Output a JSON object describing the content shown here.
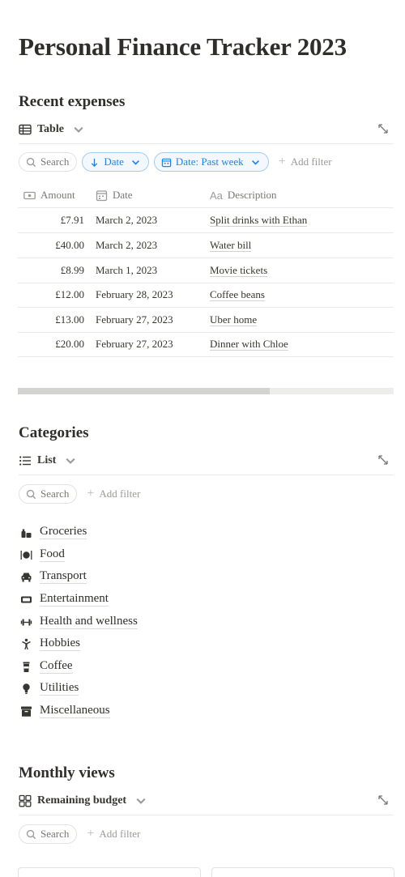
{
  "page": {
    "title": "Personal Finance Tracker 2023"
  },
  "expenses": {
    "section_title": "Recent expenses",
    "view_label": "Table",
    "search_label": "Search",
    "sort_label": "Date",
    "date_filter_label": "Date: Past week",
    "add_filter_label": "Add filter",
    "columns": {
      "amount": "Amount",
      "date": "Date",
      "description": "Description"
    },
    "rows": [
      {
        "amount": "£7.91",
        "date": "March 2, 2023",
        "description": "Split drinks with Ethan"
      },
      {
        "amount": "£40.00",
        "date": "March 2, 2023",
        "description": "Water bill"
      },
      {
        "amount": "£8.99",
        "date": "March 1, 2023",
        "description": "Movie tickets"
      },
      {
        "amount": "£12.00",
        "date": "February 28, 2023",
        "description": "Coffee beans"
      },
      {
        "amount": "£13.00",
        "date": "February 27, 2023",
        "description": "Uber home"
      },
      {
        "amount": "£20.00",
        "date": "February 27, 2023",
        "description": "Dinner with Chloe"
      }
    ],
    "scroll_fraction": 0.67
  },
  "categories": {
    "section_title": "Categories",
    "view_label": "List",
    "search_label": "Search",
    "add_filter_label": "Add filter",
    "items": [
      {
        "label": "Groceries",
        "icon": "groceries-icon"
      },
      {
        "label": "Food",
        "icon": "food-icon"
      },
      {
        "label": "Transport",
        "icon": "car-icon"
      },
      {
        "label": "Entertainment",
        "icon": "ticket-icon"
      },
      {
        "label": "Health and wellness",
        "icon": "dumbbell-icon"
      },
      {
        "label": "Hobbies",
        "icon": "person-icon"
      },
      {
        "label": "Coffee",
        "icon": "coffee-icon"
      },
      {
        "label": "Utilities",
        "icon": "lightbulb-icon"
      },
      {
        "label": "Miscellaneous",
        "icon": "archive-icon"
      }
    ]
  },
  "monthly": {
    "section_title": "Monthly views",
    "view_label": "Remaining budget",
    "search_label": "Search",
    "add_filter_label": "Add filter"
  },
  "colors": {
    "text": "#37352f",
    "accent_blue": "#2383e2",
    "muted": "#787774",
    "divider": "#e9e9e7"
  }
}
